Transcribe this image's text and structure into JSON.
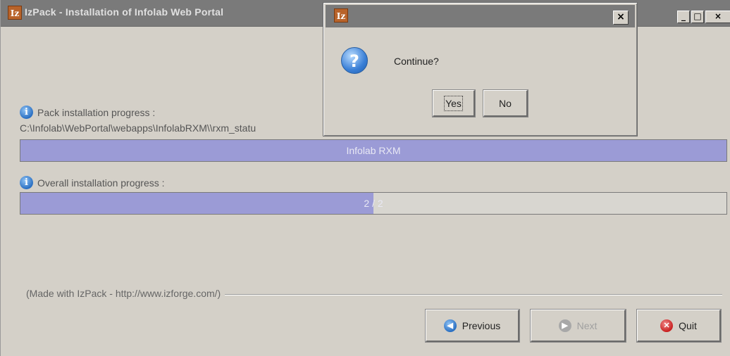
{
  "main_window": {
    "title": "IzPack - Installation of Infolab Web Portal",
    "app_icon_text": "Iz",
    "controls": {
      "minimize": "_",
      "maximize": "□",
      "close": "×"
    }
  },
  "pack_progress": {
    "label": "Pack installation progress :",
    "path": "C:\\Infolab\\WebPortal\\webapps\\InfolabRXM\\\\rxm_statu",
    "bar_text": "Infolab RXM",
    "fraction": 1.0
  },
  "overall_progress": {
    "label": "Overall installation progress :",
    "bar_text": "2 / 2",
    "fraction": 0.5
  },
  "footer": {
    "made_with": "(Made with IzPack - http://www.izforge.com/)"
  },
  "nav": {
    "previous": "Previous",
    "next": "Next",
    "quit": "Quit"
  },
  "dialog": {
    "app_icon_text": "Iz",
    "close": "×",
    "message": "Continue?",
    "yes": "Yes",
    "no": "No"
  },
  "colors": {
    "progress_fill": "#9b9bd6",
    "titlebar_inactive": "#7a7a7a",
    "window_bg": "#d4d0c8"
  },
  "icons": [
    "info-icon",
    "question-icon",
    "previous-arrow-icon",
    "next-arrow-icon",
    "quit-icon",
    "izpack-app-icon"
  ]
}
